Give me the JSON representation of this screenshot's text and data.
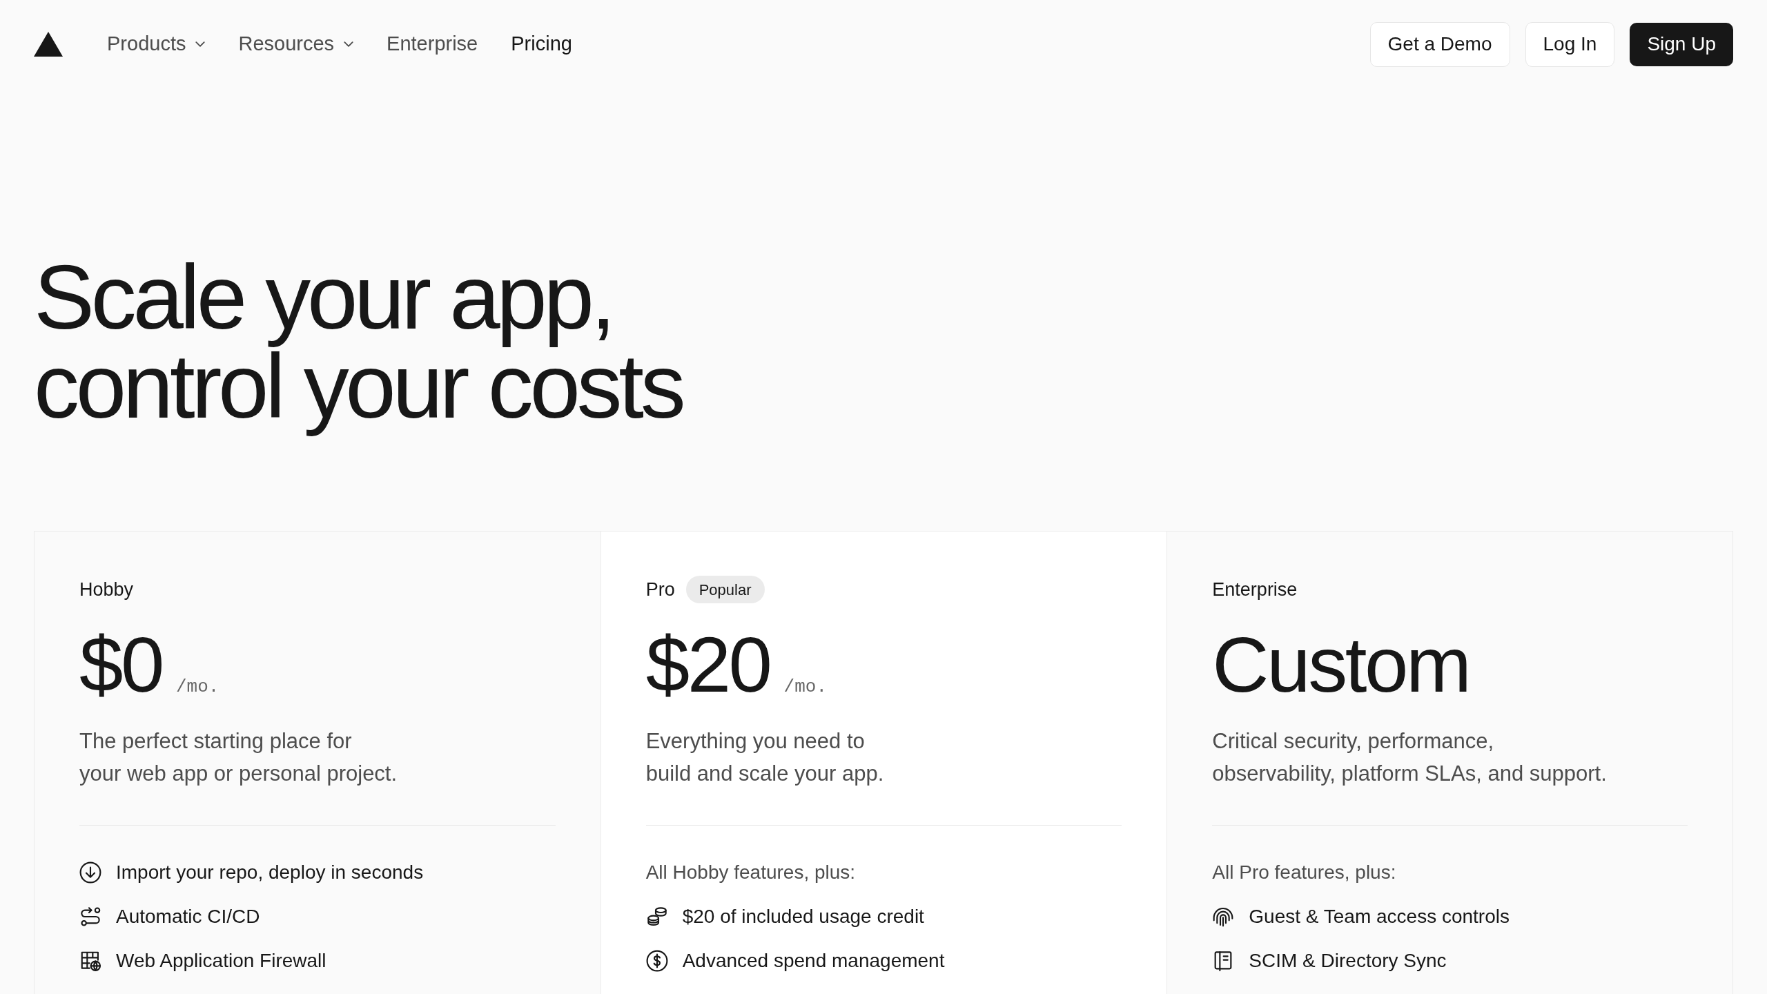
{
  "nav": {
    "items": [
      {
        "label": "Products",
        "dropdown": true,
        "selected": false
      },
      {
        "label": "Resources",
        "dropdown": true,
        "selected": false
      },
      {
        "label": "Enterprise",
        "dropdown": false,
        "selected": false
      },
      {
        "label": "Pricing",
        "dropdown": false,
        "selected": true
      }
    ]
  },
  "actions": [
    {
      "label": "Get a Demo",
      "kind": "secondary"
    },
    {
      "label": "Log In",
      "kind": "secondary"
    },
    {
      "label": "Sign Up",
      "kind": "primary"
    }
  ],
  "hero": {
    "title": "Scale your app,\ncontrol your costs"
  },
  "plans": [
    {
      "name": "Hobby",
      "price": "$0",
      "period": "/mo.",
      "description": "The perfect starting place for\nyour web app or personal project.",
      "features": [
        {
          "kind": "import",
          "text": "Import your repo, deploy in seconds"
        },
        {
          "kind": "pipeline",
          "text": "Automatic CI/CD"
        },
        {
          "kind": "firewall",
          "text": "Web Application Firewall"
        }
      ]
    },
    {
      "name": "Pro",
      "badge": "Popular",
      "price": "$20",
      "period": "/mo.",
      "description": "Everything you need to\nbuild and scale your app.",
      "features_intro": "All Hobby features, plus:",
      "features": [
        {
          "kind": "credit",
          "text": "$20 of included usage credit"
        },
        {
          "kind": "spend",
          "text": "Advanced spend management"
        }
      ]
    },
    {
      "name": "Enterprise",
      "price": "Custom",
      "description": "Critical security, performance,\nobservability, platform SLAs, and support.",
      "features_intro": "All Pro features, plus:",
      "features": [
        {
          "kind": "access",
          "text": "Guest & Team access controls"
        },
        {
          "kind": "directory",
          "text": "SCIM & Directory Sync"
        }
      ]
    }
  ]
}
